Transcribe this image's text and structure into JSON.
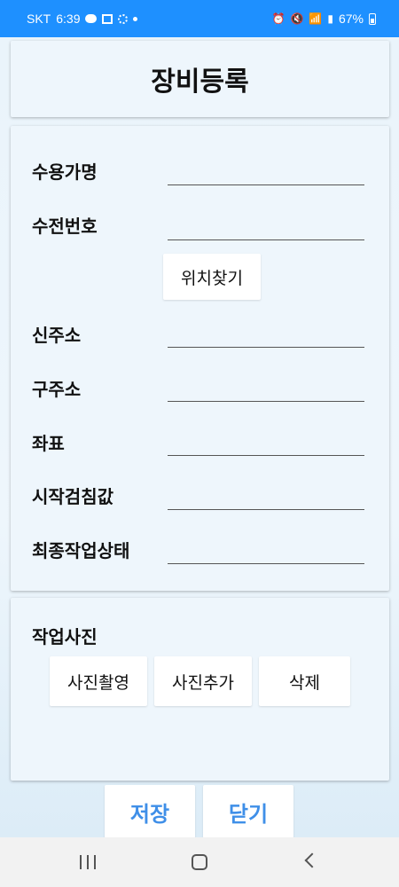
{
  "status_bar": {
    "carrier": "SKT",
    "time": "6:39",
    "battery": "67%"
  },
  "title": "장비등록",
  "form": {
    "fields": [
      {
        "label": "수용가명",
        "value": ""
      },
      {
        "label": "수전번호",
        "value": ""
      },
      {
        "label": "신주소",
        "value": ""
      },
      {
        "label": "구주소",
        "value": ""
      },
      {
        "label": "좌표",
        "value": ""
      },
      {
        "label": "시작검침값",
        "value": ""
      },
      {
        "label": "최종작업상태",
        "value": ""
      }
    ],
    "find_location_label": "위치찾기"
  },
  "photo_section": {
    "title": "작업사진",
    "take_photo_label": "사진촬영",
    "add_photo_label": "사진추가",
    "delete_label": "삭제"
  },
  "actions": {
    "save_label": "저장",
    "close_label": "닫기"
  },
  "colors": {
    "status_bar": "#1e90ff",
    "action_text": "#3f8fe8"
  },
  "icons": [
    "message-icon",
    "gallery-icon",
    "sync-icon",
    "notification-dot-icon",
    "alarm-icon",
    "mute-icon",
    "wifi-icon",
    "signal-icon",
    "battery-icon",
    "recent-apps-icon",
    "home-icon",
    "back-icon"
  ]
}
